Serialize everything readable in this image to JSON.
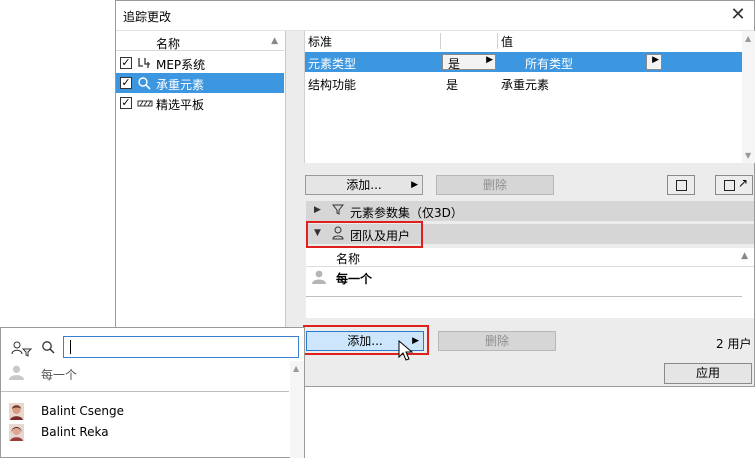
{
  "window": {
    "title": "追踪更改",
    "close_icon": "close-icon"
  },
  "left_list": {
    "header": "名称",
    "items": [
      {
        "label": "MEP系统",
        "checked": true,
        "selected": false,
        "icon": "mep-icon"
      },
      {
        "label": "承重元素",
        "checked": true,
        "selected": true,
        "icon": "structural-icon"
      },
      {
        "label": "精选平板",
        "checked": true,
        "selected": false,
        "icon": "slab-icon"
      }
    ]
  },
  "criteria": {
    "col_standard": "标准",
    "col_value": "值",
    "rows": [
      {
        "standard": "元素类型",
        "operator": "是",
        "value": "所有类型"
      },
      {
        "standard": "结构功能",
        "operator": "是",
        "value": "承重元素"
      }
    ],
    "add_label": "添加...",
    "delete_label": "删除"
  },
  "sections": {
    "element_params": "元素参数集（仅3D）",
    "team_users": "团队及用户"
  },
  "users_table": {
    "header": "名称",
    "rows": [
      {
        "name": "每一个"
      }
    ],
    "add_label": "添加...",
    "delete_label": "删除",
    "count": "2 用户"
  },
  "ok_label": "应用",
  "popup": {
    "search_value": "",
    "everyone": "每一个",
    "users": [
      {
        "name": "Balint Csenge"
      },
      {
        "name": "Balint Reka"
      }
    ]
  },
  "colors": {
    "selection": "#3c96e0",
    "highlight": "#e0201f"
  }
}
